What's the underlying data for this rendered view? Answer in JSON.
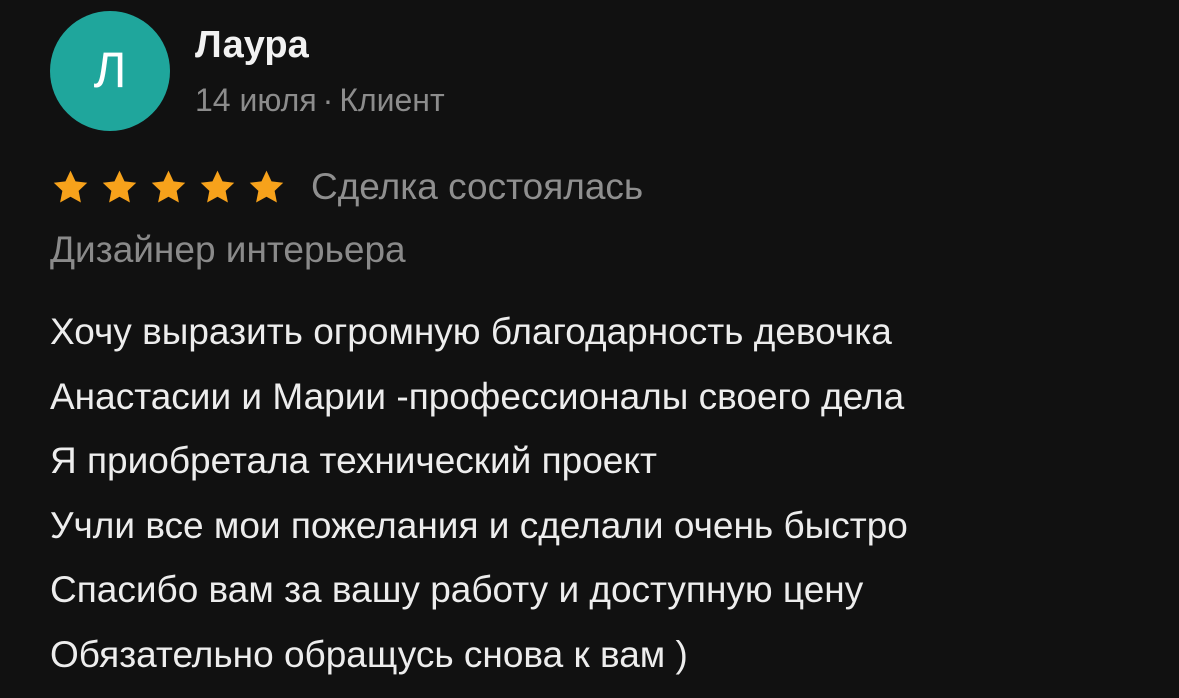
{
  "review": {
    "avatar_letter": "Л",
    "avatar_color": "#1fa69c",
    "author_name": "Лаура",
    "date": "14 июля",
    "meta_separator": "·",
    "role": "Клиент",
    "rating": 5,
    "rating_max": 5,
    "star_color": "#f7a21b",
    "deal_status": "Сделка состоялась",
    "profession": "Дизайнер интерьера",
    "text_lines": [
      "Хочу выразить огромную благодарность девочка",
      "Анастасии и Марии -профессионалы своего дела",
      "Я приобретала технический проект",
      "Учли все мои пожелания и сделали очень быстро",
      "Спасибо вам за вашу работу и доступную цену",
      "Обязательно обращусь снова к вам )"
    ]
  }
}
